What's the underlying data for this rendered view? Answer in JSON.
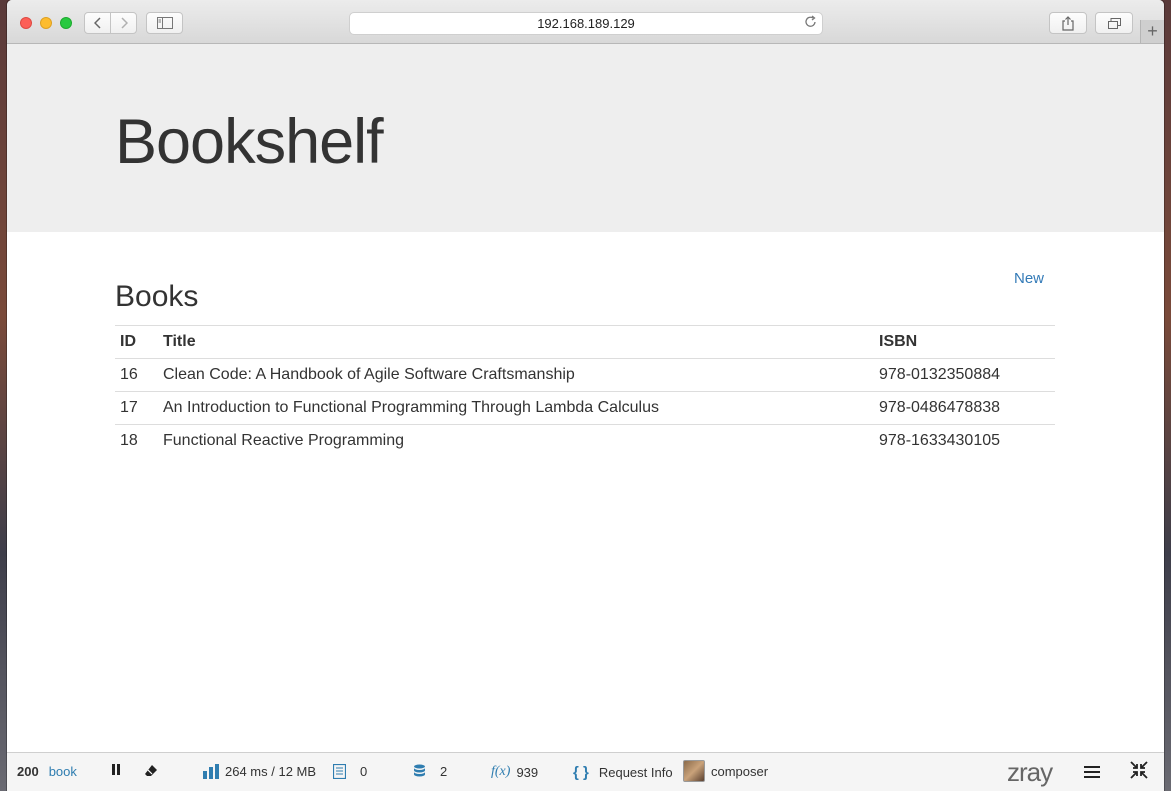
{
  "browser": {
    "url": "192.168.189.129",
    "back_icon": "chevron-left",
    "forward_icon": "chevron-right",
    "new_tab_label": "+"
  },
  "page": {
    "site_title": "Bookshelf",
    "section_title": "Books",
    "new_link": "New"
  },
  "table": {
    "headers": {
      "id": "ID",
      "title": "Title",
      "isbn": "ISBN"
    },
    "rows": [
      {
        "id": "16",
        "title": "Clean Code: A Handbook of Agile Software Craftsmanship",
        "isbn": "978-0132350884"
      },
      {
        "id": "17",
        "title": "An Introduction to Functional Programming Through Lambda Calculus",
        "isbn": "978-0486478838"
      },
      {
        "id": "18",
        "title": "Functional Reactive Programming",
        "isbn": "978-1633430105"
      }
    ]
  },
  "zray": {
    "status_code": "200",
    "page_name": "book",
    "timing": "264 ms / 12 MB",
    "log_count": "0",
    "db_count": "2",
    "functions_label": "f(x)",
    "functions_count": "939",
    "request_info_icon": "{ }",
    "request_info_label": "Request Info",
    "user_label": "composer",
    "logo": "zray"
  },
  "colors": {
    "link": "#337ab7",
    "jumbotron_bg": "#eeeeee",
    "zray_accent": "#2f7db0"
  }
}
